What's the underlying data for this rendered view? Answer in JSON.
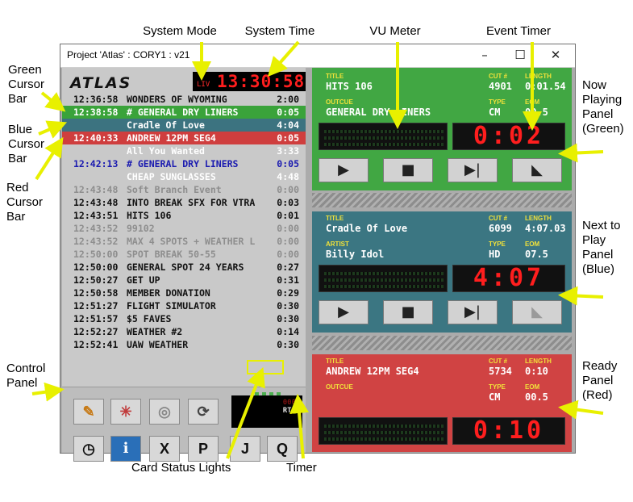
{
  "annotations": {
    "system_mode": "System Mode",
    "system_time": "System Time",
    "vu_meter": "VU Meter",
    "event_timer": "Event Timer",
    "green_cursor_bar": [
      "Green",
      "Cursor",
      "Bar"
    ],
    "blue_cursor_bar": [
      "Blue",
      "Cursor",
      "Bar"
    ],
    "red_cursor_bar": [
      "Red",
      "Cursor",
      "Bar"
    ],
    "control_panel": [
      "Control",
      "Panel"
    ],
    "now_playing_panel": [
      "Now",
      "Playing",
      "Panel",
      "(Green)"
    ],
    "next_to_play_panel": [
      "Next to",
      "Play",
      "Panel",
      "(Blue)"
    ],
    "ready_panel": [
      "Ready",
      "Panel",
      "(Red)"
    ],
    "card_status_lights": "Card Status Lights",
    "timer": "Timer"
  },
  "window": {
    "title": "Project 'Atlas' : CORY1 : v21",
    "minimize_glyph": "–",
    "maximize_glyph": "☐",
    "close_glyph": "✕"
  },
  "header": {
    "logo": "ATLAS",
    "mode": "LIV",
    "time": "13:30:58"
  },
  "log": [
    {
      "time": "12:36:58",
      "name": "WONDERS OF WYOMING",
      "dur": "2:00",
      "style": "black"
    },
    {
      "time": "12:38:58",
      "name": "# GENERAL DRY LINERS",
      "dur": "0:05",
      "style": "green"
    },
    {
      "time": "",
      "name": "Cradle Of Love",
      "dur": "4:04",
      "style": "blue"
    },
    {
      "time": "12:40:33",
      "name": "ANDREW 12PM SEG4",
      "dur": "0:05",
      "style": "red"
    },
    {
      "time": "",
      "name": "All You Wanted",
      "dur": "3:33",
      "style": "white"
    },
    {
      "time": "12:42:13",
      "name": "# GENERAL DRY LINERS",
      "dur": "0:05",
      "style": "navy"
    },
    {
      "time": "",
      "name": "CHEAP SUNGLASSES",
      "dur": "4:48",
      "style": "white"
    },
    {
      "time": "12:43:48",
      "name": "Soft Branch Event",
      "dur": "0:00",
      "style": "grey"
    },
    {
      "time": "12:43:48",
      "name": "INTO BREAK SFX FOR VTRA",
      "dur": "0:03",
      "style": "black"
    },
    {
      "time": "12:43:51",
      "name": "HITS 106",
      "dur": "0:01",
      "style": "black"
    },
    {
      "time": "12:43:52",
      "name": "99102",
      "dur": "0:00",
      "style": "grey"
    },
    {
      "time": "12:43:52",
      "name": "MAX 4 SPOTS + WEATHER L",
      "dur": "0:00",
      "style": "grey"
    },
    {
      "time": "12:50:00",
      "name": "SPOT BREAK 50-55",
      "dur": "0:00",
      "style": "grey"
    },
    {
      "time": "12:50:00",
      "name": "GENERAL SPOT 24 YEARS",
      "dur": "0:27",
      "style": "black"
    },
    {
      "time": "12:50:27",
      "name": "GET UP",
      "dur": "0:31",
      "style": "black"
    },
    {
      "time": "12:50:58",
      "name": "MEMBER DONATION",
      "dur": "0:29",
      "style": "black"
    },
    {
      "time": "12:51:27",
      "name": "FLIGHT SIMULATOR",
      "dur": "0:30",
      "style": "black"
    },
    {
      "time": "12:51:57",
      "name": "$5 FAVES",
      "dur": "0:30",
      "style": "black"
    },
    {
      "time": "12:52:27",
      "name": "WEATHER #2",
      "dur": "0:14",
      "style": "black"
    },
    {
      "time": "12:52:41",
      "name": "UAW WEATHER",
      "dur": "0:30",
      "style": "black"
    }
  ],
  "controls": {
    "row1": [
      "✎",
      "✳",
      "◎",
      "⟳"
    ],
    "row2": [
      "◷",
      "i",
      "X",
      "P",
      "J",
      "Q"
    ],
    "timer_top": "000",
    "timer_rts": "RTS"
  },
  "panels": {
    "green": {
      "title_label": "TITLE",
      "title": "HITS 106",
      "cut_label": "CUT #",
      "cut": "4901",
      "length_label": "LENGTH",
      "length": "0:01.54",
      "second_label": "OUTCUE",
      "second": "GENERAL DRY LINERS",
      "type_label": "TYPE",
      "type": "CM",
      "eom_label": "EOM",
      "eom": "00.5",
      "timer": "0:02"
    },
    "blue": {
      "title_label": "TITLE",
      "title": "Cradle Of Love",
      "cut_label": "CUT #",
      "cut": "6099",
      "length_label": "LENGTH",
      "length": "4:07.03",
      "second_label": "ARTIST",
      "second": "Billy Idol",
      "type_label": "TYPE",
      "type": "HD",
      "eom_label": "EOM",
      "eom": "07.5",
      "timer": "4:07"
    },
    "red": {
      "title_label": "TITLE",
      "title": "ANDREW 12PM SEG4",
      "cut_label": "CUT #",
      "cut": "5734",
      "length_label": "LENGTH",
      "length": "0:10",
      "second_label": "OUTCUE",
      "second": "",
      "type_label": "TYPE",
      "type": "CM",
      "eom_label": "EOM",
      "eom": "00.5",
      "timer": "0:10"
    },
    "transport": {
      "play": "▶",
      "stop": "■",
      "next": "▶|",
      "fade": "◣"
    }
  }
}
